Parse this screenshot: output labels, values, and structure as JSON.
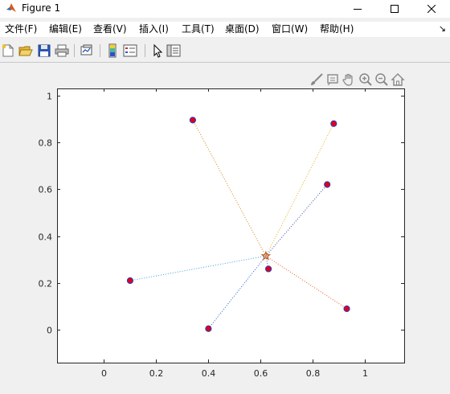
{
  "window": {
    "title": "Figure 1"
  },
  "menu": {
    "items": [
      {
        "name": "menu-file",
        "label": "文件(F)"
      },
      {
        "name": "menu-edit",
        "label": "编辑(E)"
      },
      {
        "name": "menu-view",
        "label": "查看(V)"
      },
      {
        "name": "menu-insert",
        "label": "插入(I)"
      },
      {
        "name": "menu-tools",
        "label": "工具(T)"
      },
      {
        "name": "menu-desktop",
        "label": "桌面(D)"
      },
      {
        "name": "menu-window",
        "label": "窗口(W)"
      },
      {
        "name": "menu-help",
        "label": "帮助(H)"
      }
    ],
    "dock_arrow": "↘"
  },
  "toolbar": {
    "buttons": [
      "new-figure-icon",
      "open-file-icon",
      "save-icon",
      "print-icon",
      "link-plot-icon",
      "colorbar-icon",
      "legend-icon",
      "edit-plot-arrow-icon",
      "property-inspector-icon"
    ]
  },
  "axes_toolbar": {
    "buttons": [
      "brush-icon",
      "data-tips-icon",
      "pan-hand-icon",
      "zoom-in-icon",
      "zoom-out-icon",
      "home-restore-view-icon"
    ]
  },
  "chart_data": {
    "type": "scatter",
    "title": "",
    "xlabel": "",
    "ylabel": "",
    "xlim": [
      -0.18,
      1.15
    ],
    "ylim": [
      -0.14,
      1.03
    ],
    "xticks": [
      0,
      0.2,
      0.4,
      0.6,
      0.8,
      1
    ],
    "xtick_labels": [
      "0",
      "0.2",
      "0.4",
      "0.6",
      "0.8",
      "1"
    ],
    "yticks": [
      0,
      0.2,
      0.4,
      0.6,
      0.8,
      1
    ],
    "ytick_labels": [
      "0",
      "0.2",
      "0.4",
      "0.6",
      "0.8",
      "1"
    ],
    "grid": false,
    "background": "#ffffff",
    "center": {
      "x": 0.62,
      "y": 0.315,
      "marker": "star",
      "color": "#c05a1c"
    },
    "points": [
      {
        "x": 0.34,
        "y": 0.895
      },
      {
        "x": 0.88,
        "y": 0.88
      },
      {
        "x": 0.855,
        "y": 0.62
      },
      {
        "x": 0.1,
        "y": 0.21
      },
      {
        "x": 0.63,
        "y": 0.26
      },
      {
        "x": 0.4,
        "y": 0.005
      },
      {
        "x": 0.93,
        "y": 0.09
      }
    ],
    "point_style": {
      "fill": "#e0001a",
      "edge": "#2a3fbf"
    },
    "lines": [
      {
        "to": 0,
        "color": "#d18a1a"
      },
      {
        "to": 1,
        "color": "#e0b020"
      },
      {
        "to": 2,
        "color": "#3a4aa0"
      },
      {
        "to": 3,
        "color": "#3aa0e0"
      },
      {
        "to": 4,
        "color": "#4060c0"
      },
      {
        "to": 5,
        "color": "#2060c0"
      },
      {
        "to": 6,
        "color": "#e06020"
      }
    ]
  }
}
